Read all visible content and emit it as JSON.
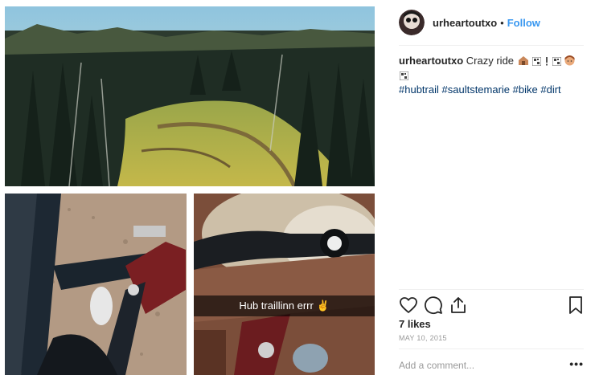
{
  "post": {
    "overlay_caption": "Hub traillinn errr"
  },
  "header": {
    "username": "urheartoutxo",
    "separator": "•",
    "follow_label": "Follow"
  },
  "caption": {
    "username": "urheartoutxo",
    "text": "Crazy ride",
    "emoji_icons": [
      "house-emoji-icon",
      "qr-emoji-icon",
      "exclamation-emoji-icon",
      "qr-emoji-icon",
      "girl-face-emoji-icon",
      "qr-emoji-icon"
    ],
    "hashtags": [
      "#hubtrail",
      "#saultstemarie",
      "#bike",
      "#dirt"
    ]
  },
  "actions": {
    "icons": [
      "heart-icon",
      "comment-icon",
      "share-icon",
      "bookmark-icon"
    ]
  },
  "stats": {
    "likes": "7 likes",
    "date": "MAY 10, 2015"
  },
  "comment": {
    "placeholder": "Add a comment...",
    "more_label": "•••"
  },
  "colors": {
    "accent": "#3897f0",
    "hashtag": "#003569",
    "muted": "#999999",
    "text": "#262626"
  }
}
